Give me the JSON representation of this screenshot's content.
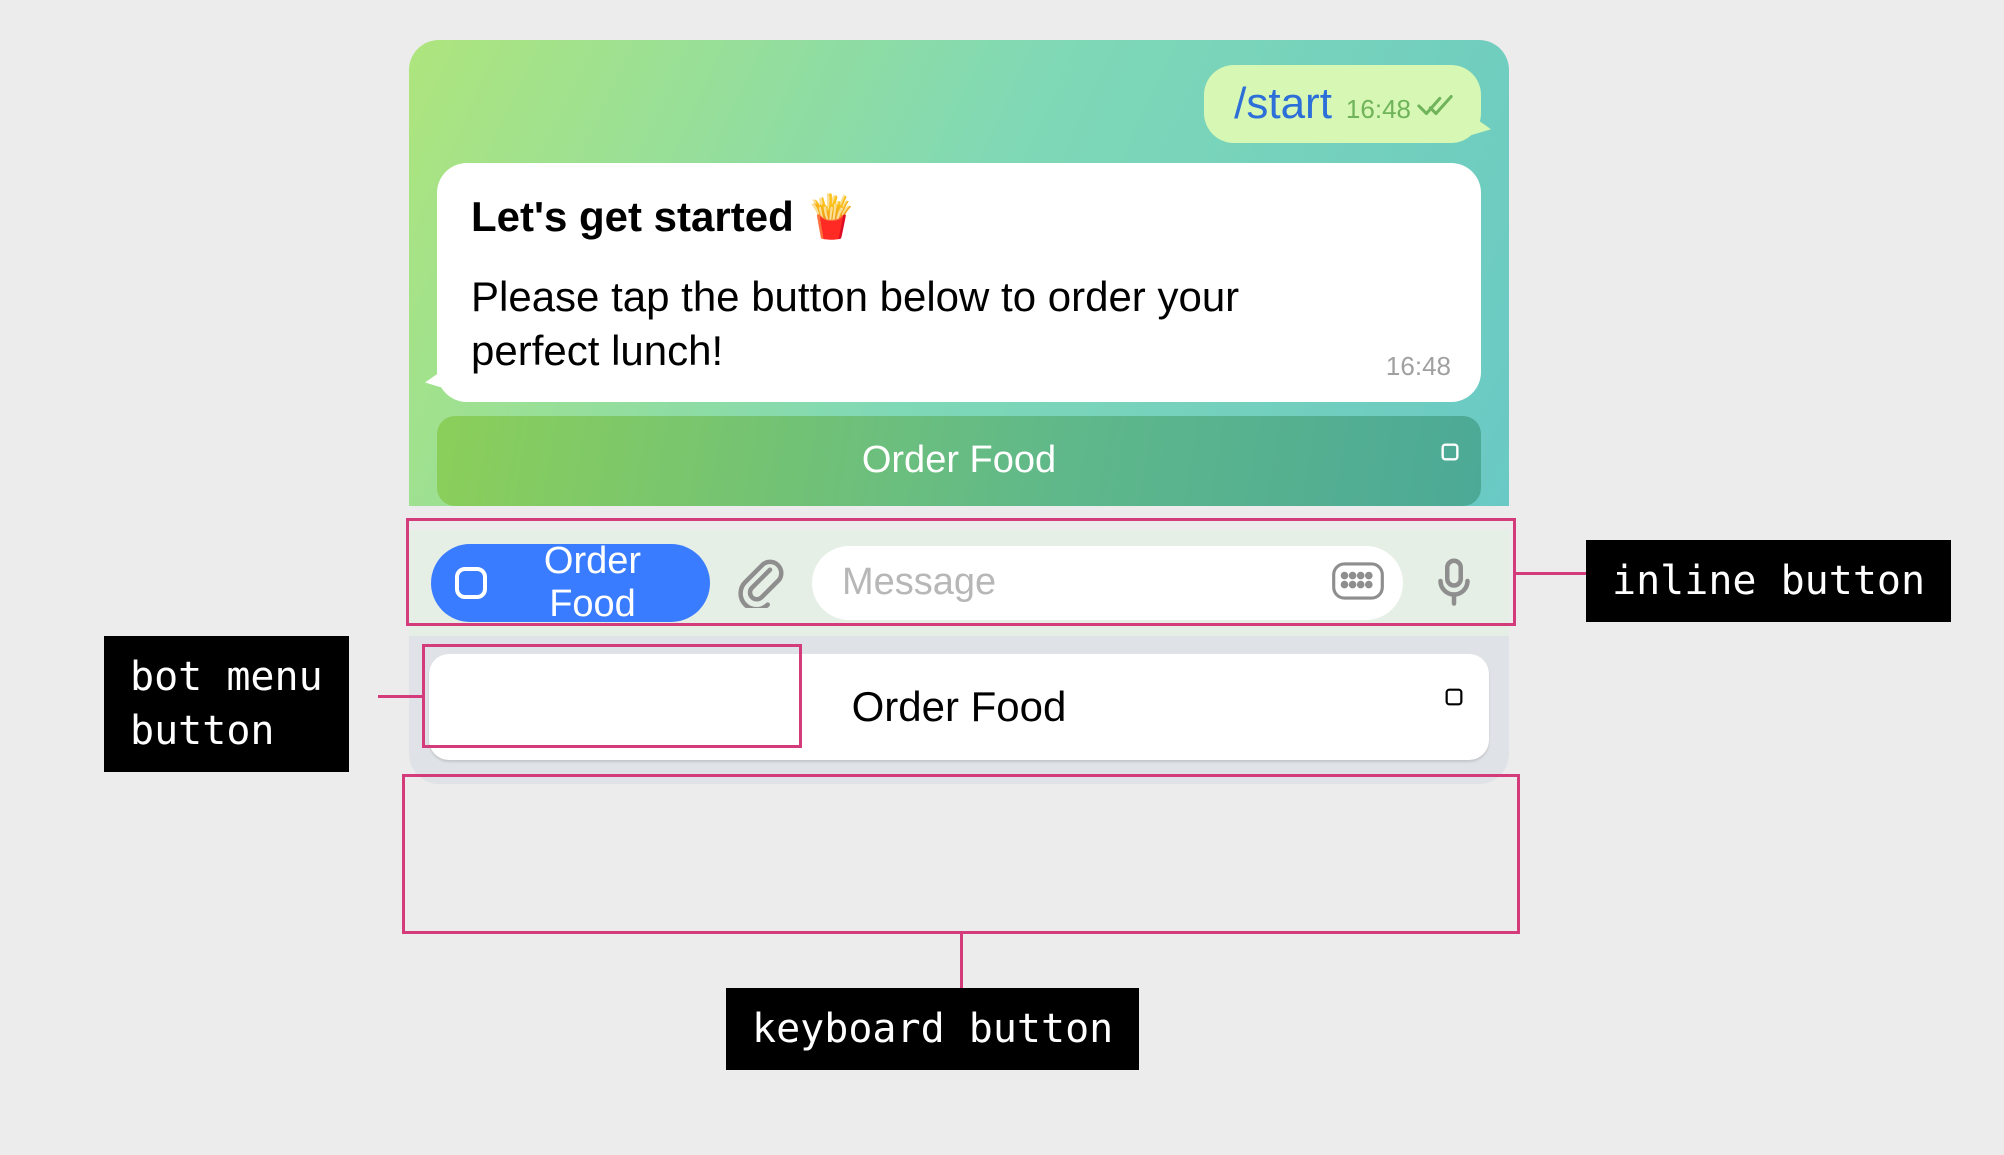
{
  "outgoing": {
    "text": "/start",
    "time": "16:48"
  },
  "incoming": {
    "title": "Let's get started 🍟",
    "body": "Please tap the button below to order your perfect lunch!",
    "time": "16:48"
  },
  "inline_button": {
    "label": "Order Food"
  },
  "menu_button": {
    "label": "Order Food"
  },
  "message_input": {
    "placeholder": "Message"
  },
  "keyboard_button": {
    "label": "Order Food"
  },
  "annotations": {
    "inline": "inline button",
    "menu": "bot menu\nbutton",
    "keyboard": "keyboard button"
  },
  "colors": {
    "highlight": "#d43b7a",
    "menu_blue": "#3a7cff",
    "link_blue": "#2c6fd8"
  }
}
